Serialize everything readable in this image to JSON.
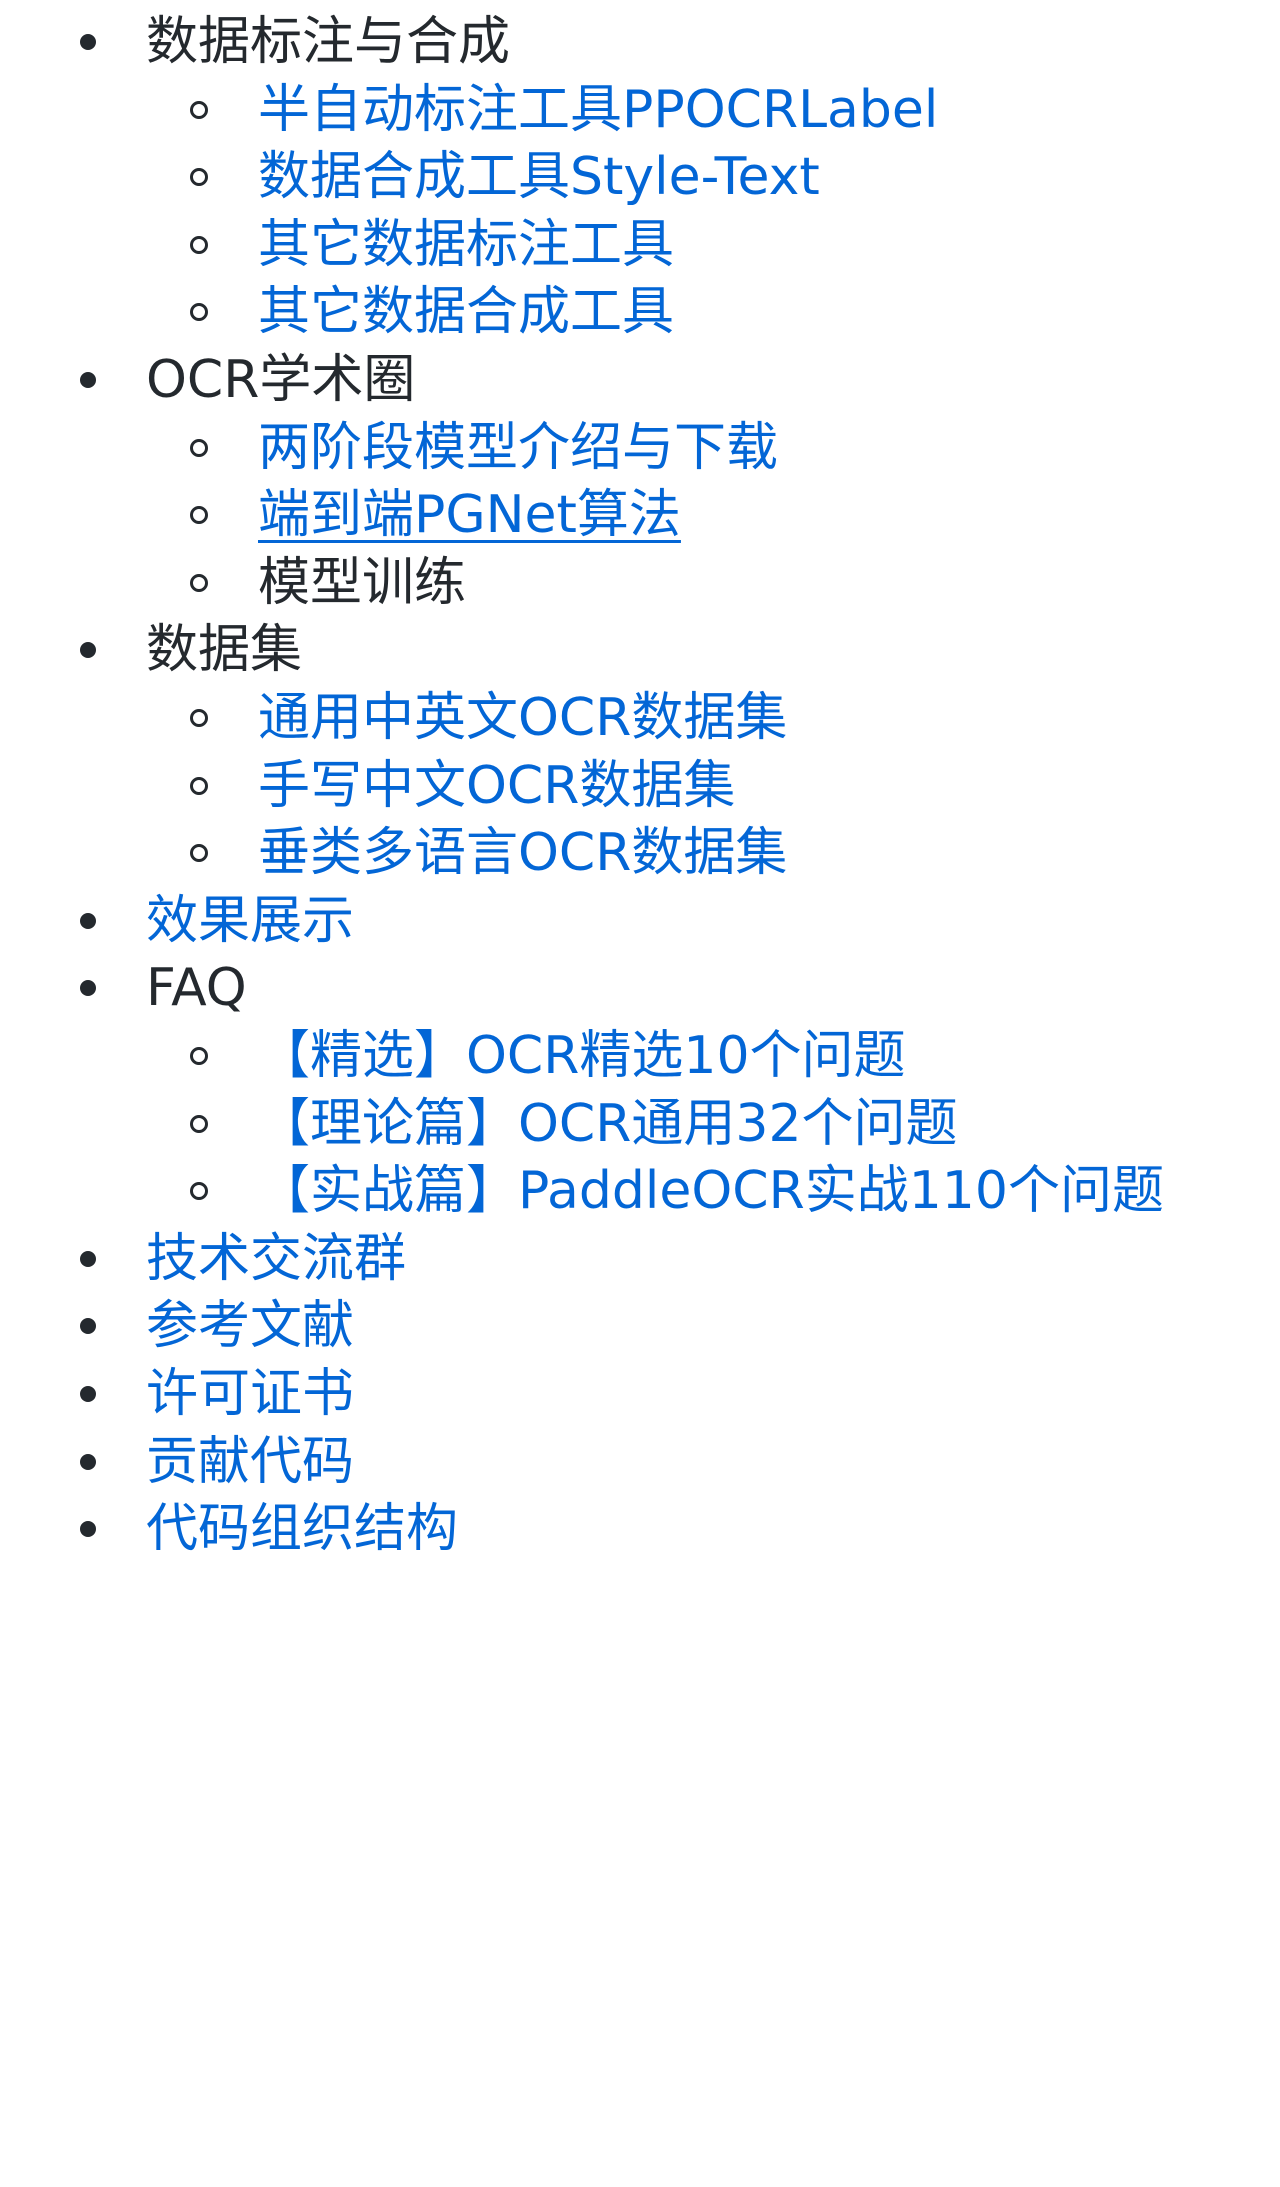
{
  "toc": {
    "items": [
      {
        "text": "数据标注与合成",
        "level": 1,
        "link": false
      },
      {
        "text": "半自动标注工具PPOCRLabel",
        "level": 2,
        "link": true
      },
      {
        "text": "数据合成工具Style-Text",
        "level": 2,
        "link": true
      },
      {
        "text": "其它数据标注工具",
        "level": 2,
        "link": true
      },
      {
        "text": "其它数据合成工具",
        "level": 2,
        "link": true
      },
      {
        "text": "OCR学术圈",
        "level": 1,
        "link": false
      },
      {
        "text": "两阶段模型介绍与下载",
        "level": 2,
        "link": true
      },
      {
        "text": "端到端PGNet算法",
        "level": 2,
        "link": true,
        "underlined": true
      },
      {
        "text": "模型训练",
        "level": 2,
        "link": false
      },
      {
        "text": "数据集",
        "level": 1,
        "link": false
      },
      {
        "text": "通用中英文OCR数据集",
        "level": 2,
        "link": true
      },
      {
        "text": "手写中文OCR数据集",
        "level": 2,
        "link": true
      },
      {
        "text": "垂类多语言OCR数据集",
        "level": 2,
        "link": true
      },
      {
        "text": "效果展示",
        "level": 1,
        "link": true
      },
      {
        "text": "FAQ",
        "level": 1,
        "link": false
      },
      {
        "text": "【精选】OCR精选10个问题",
        "level": 2,
        "link": true
      },
      {
        "text": "【理论篇】OCR通用32个问题",
        "level": 2,
        "link": true
      },
      {
        "text": "【实战篇】PaddleOCR实战110个问题",
        "level": 2,
        "link": true
      },
      {
        "text": "技术交流群",
        "level": 1,
        "link": true
      },
      {
        "text": "参考文献",
        "level": 1,
        "link": true
      },
      {
        "text": "许可证书",
        "level": 1,
        "link": true
      },
      {
        "text": "贡献代码",
        "level": 1,
        "link": true
      },
      {
        "text": "代码组织结构",
        "level": 1,
        "link": true
      }
    ]
  },
  "colors": {
    "link": "#0366d6",
    "text": "#24292e",
    "background": "#ffffff"
  }
}
